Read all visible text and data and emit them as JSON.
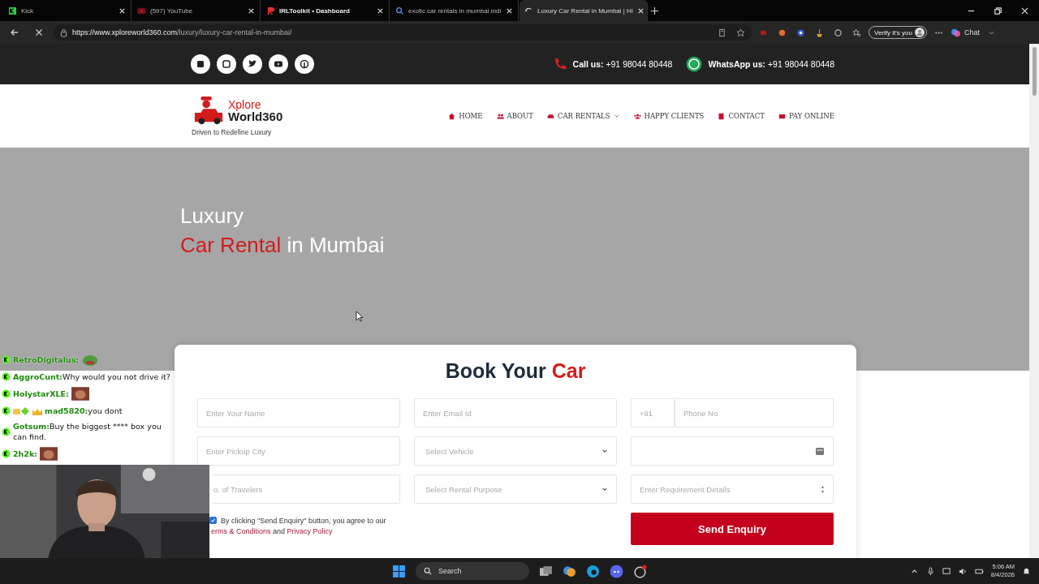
{
  "browser": {
    "tabs": [
      {
        "title": "Kick",
        "selected": false
      },
      {
        "title": "(597) YouTube",
        "selected": false
      },
      {
        "title": "IRLToolkit • Dashboard",
        "selected": false
      },
      {
        "title": "exotic car rentals in mumbai indi",
        "selected": false
      },
      {
        "title": "Luxury Car Rental in Mumbai | Hi",
        "selected": true
      }
    ],
    "url_host": "https://www.xploreworld360.com",
    "url_path": "/luxury/luxury-car-rental-in-mumbai/",
    "verify_label": "Verify it's you",
    "chat_label": "Chat"
  },
  "site": {
    "topbar": {
      "call_label": "Call us:",
      "call_number": "+91 98044 80448",
      "whatsapp_label": "WhatsApp us:",
      "whatsapp_number": "+91 98044 80448"
    },
    "logo": {
      "line1": "Xplore",
      "line2": "World360",
      "tagline": "Driven to Redefine Luxury"
    },
    "nav": [
      {
        "label": "HOME",
        "dropdown": false
      },
      {
        "label": "ABOUT",
        "dropdown": false
      },
      {
        "label": "CAR RENTALS",
        "dropdown": true
      },
      {
        "label": "HAPPY CLIENTS",
        "dropdown": false
      },
      {
        "label": "CONTACT",
        "dropdown": false
      },
      {
        "label": "PAY ONLINE",
        "dropdown": false
      }
    ],
    "hero": {
      "line1": "Luxury",
      "highlight": "Car Rental",
      "rest": "in Mumbai"
    },
    "form": {
      "title": "Book Your",
      "title_highlight": "Car",
      "fields": [
        {
          "kind": "input",
          "placeholder": "Enter Your Name"
        },
        {
          "kind": "input",
          "placeholder": "Enter Email Id"
        },
        {
          "kind": "phone",
          "prefix": "+91",
          "placeholder": "Phone No"
        },
        {
          "kind": "input",
          "placeholder": "Enter Pickup City"
        },
        {
          "kind": "select",
          "placeholder": "Select Vehicle"
        },
        {
          "kind": "date"
        },
        {
          "kind": "input",
          "placeholder": "o. of Travelers"
        },
        {
          "kind": "select",
          "placeholder": "Select Rental Purpose"
        },
        {
          "kind": "textarea",
          "placeholder": "Enter Requirement Details"
        }
      ],
      "consent": {
        "checked": true,
        "text": "By clicking \"Send Enquiry\" button, you agree to our",
        "terms": "erms & Conditions",
        "joiner": "and",
        "privacy": "Privacy Policy"
      },
      "submit": "Send Enquiry"
    }
  },
  "chat": [
    {
      "user": "RetroDigitalus:",
      "badges": false
    },
    {
      "user": "AggroCunt:",
      "message": "Why would you not drive it?",
      "badges": false
    },
    {
      "user": "HolystarXLE:",
      "badges": false
    },
    {
      "user": "mad5820:",
      "message": "you dont",
      "badges": true
    },
    {
      "user": "Gotsum:",
      "message": "Buy the biggest **** box you can find.",
      "badges": false
    },
    {
      "user": "2h2k:",
      "badges": false
    }
  ],
  "taskbar": {
    "search": "Search",
    "time": "5:06 AM",
    "date": "8/4/2026"
  }
}
